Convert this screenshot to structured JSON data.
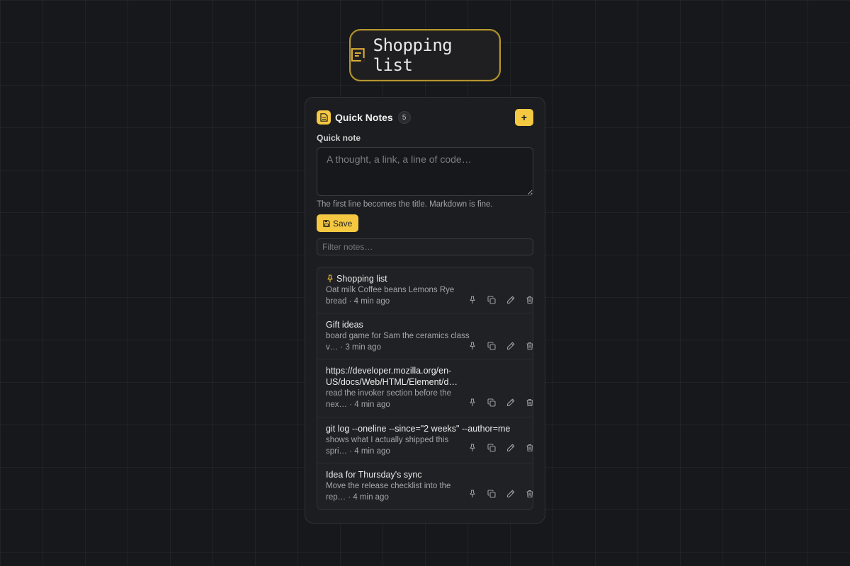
{
  "pill": {
    "text": "Shopping list",
    "icon": "note-icon"
  },
  "app": {
    "title": "Quick Notes",
    "count": "5",
    "add_label": "+"
  },
  "composer": {
    "label": "Quick note",
    "placeholder": "A thought, a link, a line of code…",
    "value": "",
    "hint": "The first line becomes the title. Markdown is fine.",
    "save_label": "Save"
  },
  "filter": {
    "placeholder": "Filter notes…",
    "value": ""
  },
  "notes": [
    {
      "title": "Shopping list",
      "pinned": true,
      "preview": "Oat milk Coffee beans Lemons Rye bread · 4 min ago"
    },
    {
      "title": "Gift ideas",
      "pinned": false,
      "preview": "board game for Sam the ceramics class v… · 3 min ago"
    },
    {
      "title": "https://developer.mozilla.org/en-US/docs/Web/HTML/Element/d…",
      "pinned": false,
      "preview": "read the invoker section before the nex… · 4 min ago"
    },
    {
      "title": "git log --oneline --since=\"2 weeks\" --author=me",
      "pinned": false,
      "preview": "shows what I actually shipped this spri… · 4 min ago"
    },
    {
      "title": "Idea for Thursday's sync",
      "pinned": false,
      "preview": "Move the release checklist into the rep… · 4 min ago"
    }
  ],
  "colors": {
    "accent": "#f5c842",
    "background": "#17181b",
    "panel": "#1c1d20",
    "pill_border": "#b5962f"
  }
}
